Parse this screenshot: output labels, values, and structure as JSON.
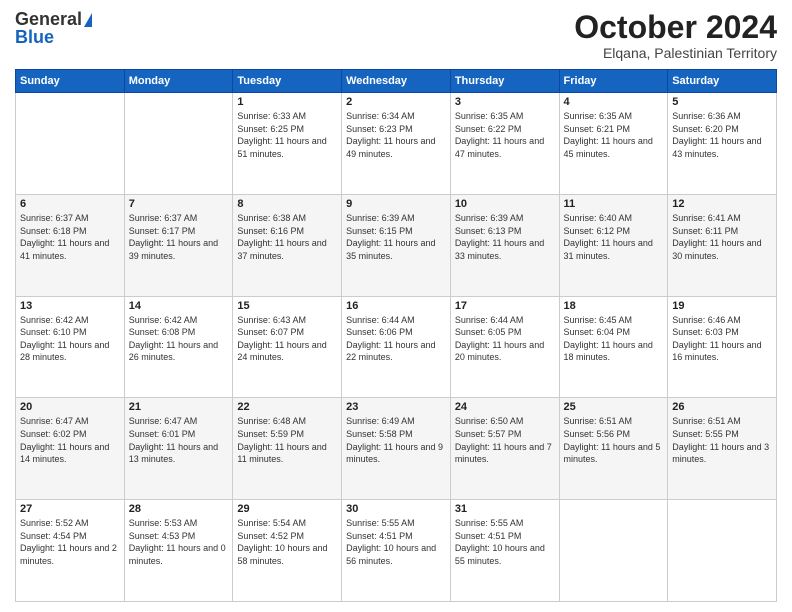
{
  "header": {
    "logo_top": "General",
    "logo_bottom": "Blue",
    "title": "October 2024",
    "subtitle": "Elqana, Palestinian Territory"
  },
  "days_of_week": [
    "Sunday",
    "Monday",
    "Tuesday",
    "Wednesday",
    "Thursday",
    "Friday",
    "Saturday"
  ],
  "weeks": [
    [
      {
        "day": "",
        "info": ""
      },
      {
        "day": "",
        "info": ""
      },
      {
        "day": "1",
        "info": "Sunrise: 6:33 AM\nSunset: 6:25 PM\nDaylight: 11 hours and 51 minutes."
      },
      {
        "day": "2",
        "info": "Sunrise: 6:34 AM\nSunset: 6:23 PM\nDaylight: 11 hours and 49 minutes."
      },
      {
        "day": "3",
        "info": "Sunrise: 6:35 AM\nSunset: 6:22 PM\nDaylight: 11 hours and 47 minutes."
      },
      {
        "day": "4",
        "info": "Sunrise: 6:35 AM\nSunset: 6:21 PM\nDaylight: 11 hours and 45 minutes."
      },
      {
        "day": "5",
        "info": "Sunrise: 6:36 AM\nSunset: 6:20 PM\nDaylight: 11 hours and 43 minutes."
      }
    ],
    [
      {
        "day": "6",
        "info": "Sunrise: 6:37 AM\nSunset: 6:18 PM\nDaylight: 11 hours and 41 minutes."
      },
      {
        "day": "7",
        "info": "Sunrise: 6:37 AM\nSunset: 6:17 PM\nDaylight: 11 hours and 39 minutes."
      },
      {
        "day": "8",
        "info": "Sunrise: 6:38 AM\nSunset: 6:16 PM\nDaylight: 11 hours and 37 minutes."
      },
      {
        "day": "9",
        "info": "Sunrise: 6:39 AM\nSunset: 6:15 PM\nDaylight: 11 hours and 35 minutes."
      },
      {
        "day": "10",
        "info": "Sunrise: 6:39 AM\nSunset: 6:13 PM\nDaylight: 11 hours and 33 minutes."
      },
      {
        "day": "11",
        "info": "Sunrise: 6:40 AM\nSunset: 6:12 PM\nDaylight: 11 hours and 31 minutes."
      },
      {
        "day": "12",
        "info": "Sunrise: 6:41 AM\nSunset: 6:11 PM\nDaylight: 11 hours and 30 minutes."
      }
    ],
    [
      {
        "day": "13",
        "info": "Sunrise: 6:42 AM\nSunset: 6:10 PM\nDaylight: 11 hours and 28 minutes."
      },
      {
        "day": "14",
        "info": "Sunrise: 6:42 AM\nSunset: 6:08 PM\nDaylight: 11 hours and 26 minutes."
      },
      {
        "day": "15",
        "info": "Sunrise: 6:43 AM\nSunset: 6:07 PM\nDaylight: 11 hours and 24 minutes."
      },
      {
        "day": "16",
        "info": "Sunrise: 6:44 AM\nSunset: 6:06 PM\nDaylight: 11 hours and 22 minutes."
      },
      {
        "day": "17",
        "info": "Sunrise: 6:44 AM\nSunset: 6:05 PM\nDaylight: 11 hours and 20 minutes."
      },
      {
        "day": "18",
        "info": "Sunrise: 6:45 AM\nSunset: 6:04 PM\nDaylight: 11 hours and 18 minutes."
      },
      {
        "day": "19",
        "info": "Sunrise: 6:46 AM\nSunset: 6:03 PM\nDaylight: 11 hours and 16 minutes."
      }
    ],
    [
      {
        "day": "20",
        "info": "Sunrise: 6:47 AM\nSunset: 6:02 PM\nDaylight: 11 hours and 14 minutes."
      },
      {
        "day": "21",
        "info": "Sunrise: 6:47 AM\nSunset: 6:01 PM\nDaylight: 11 hours and 13 minutes."
      },
      {
        "day": "22",
        "info": "Sunrise: 6:48 AM\nSunset: 5:59 PM\nDaylight: 11 hours and 11 minutes."
      },
      {
        "day": "23",
        "info": "Sunrise: 6:49 AM\nSunset: 5:58 PM\nDaylight: 11 hours and 9 minutes."
      },
      {
        "day": "24",
        "info": "Sunrise: 6:50 AM\nSunset: 5:57 PM\nDaylight: 11 hours and 7 minutes."
      },
      {
        "day": "25",
        "info": "Sunrise: 6:51 AM\nSunset: 5:56 PM\nDaylight: 11 hours and 5 minutes."
      },
      {
        "day": "26",
        "info": "Sunrise: 6:51 AM\nSunset: 5:55 PM\nDaylight: 11 hours and 3 minutes."
      }
    ],
    [
      {
        "day": "27",
        "info": "Sunrise: 5:52 AM\nSunset: 4:54 PM\nDaylight: 11 hours and 2 minutes."
      },
      {
        "day": "28",
        "info": "Sunrise: 5:53 AM\nSunset: 4:53 PM\nDaylight: 11 hours and 0 minutes."
      },
      {
        "day": "29",
        "info": "Sunrise: 5:54 AM\nSunset: 4:52 PM\nDaylight: 10 hours and 58 minutes."
      },
      {
        "day": "30",
        "info": "Sunrise: 5:55 AM\nSunset: 4:51 PM\nDaylight: 10 hours and 56 minutes."
      },
      {
        "day": "31",
        "info": "Sunrise: 5:55 AM\nSunset: 4:51 PM\nDaylight: 10 hours and 55 minutes."
      },
      {
        "day": "",
        "info": ""
      },
      {
        "day": "",
        "info": ""
      }
    ]
  ]
}
